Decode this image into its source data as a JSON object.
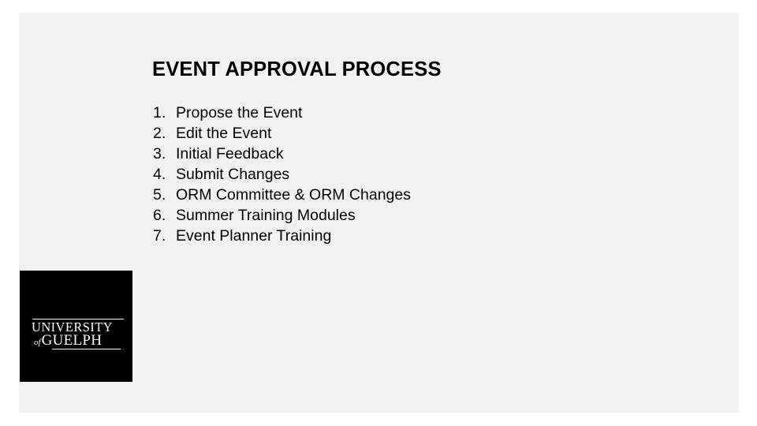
{
  "slide": {
    "title": "EVENT APPROVAL PROCESS",
    "background_color": "#f1f1f1",
    "canvas_color": "#ffffff",
    "text_color": "#000000",
    "list": [
      {
        "marker": "1.",
        "label": "Propose the Event"
      },
      {
        "marker": "2.",
        "label": "Edit the Event"
      },
      {
        "marker": "3.",
        "label": "Initial Feedback"
      },
      {
        "marker": "4.",
        "label": "Submit Changes"
      },
      {
        "marker": "5.",
        "label": "ORM Committee & ORM Changes"
      },
      {
        "marker": "6.",
        "label": "Summer Training Modules"
      },
      {
        "marker": "7.",
        "label": "Event Planner Training"
      }
    ]
  },
  "logo": {
    "name": "university-of-guelph-logo",
    "line_one": "UNIVERSITY",
    "connector": "of",
    "line_two": "GUELPH",
    "background_color": "#000000",
    "text_color": "#ffffff"
  }
}
